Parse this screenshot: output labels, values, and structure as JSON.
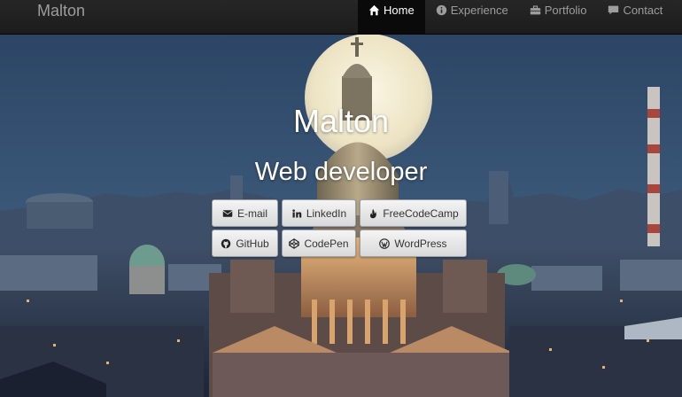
{
  "navbar": {
    "brand": "Malton",
    "items": [
      {
        "label": "Home",
        "icon": "home-icon",
        "active": true
      },
      {
        "label": "Experience",
        "icon": "info-circle-icon",
        "active": false
      },
      {
        "label": "Portfolio",
        "icon": "briefcase-icon",
        "active": false
      },
      {
        "label": "Contact",
        "icon": "comment-icon",
        "active": false
      }
    ]
  },
  "hero": {
    "title": "Malton",
    "subtitle": "Web developer",
    "background": "night-city-moon-cathedral"
  },
  "links": {
    "email": {
      "label": "E-mail",
      "icon": "envelope-icon"
    },
    "linkedin": {
      "label": "LinkedIn",
      "icon": "linkedin-icon"
    },
    "freecodecamp": {
      "label": "FreeCodeCamp",
      "icon": "fire-icon"
    },
    "github": {
      "label": "GitHub",
      "icon": "github-icon"
    },
    "codepen": {
      "label": "CodePen",
      "icon": "codepen-icon"
    },
    "wordpress": {
      "label": "WordPress",
      "icon": "wordpress-icon"
    }
  },
  "colors": {
    "navbar": "#222222",
    "nav_text": "#9d9d9d",
    "nav_active_bg": "#0a0a0a",
    "sky": "#2b4466",
    "moon": "#f3ecd4"
  }
}
